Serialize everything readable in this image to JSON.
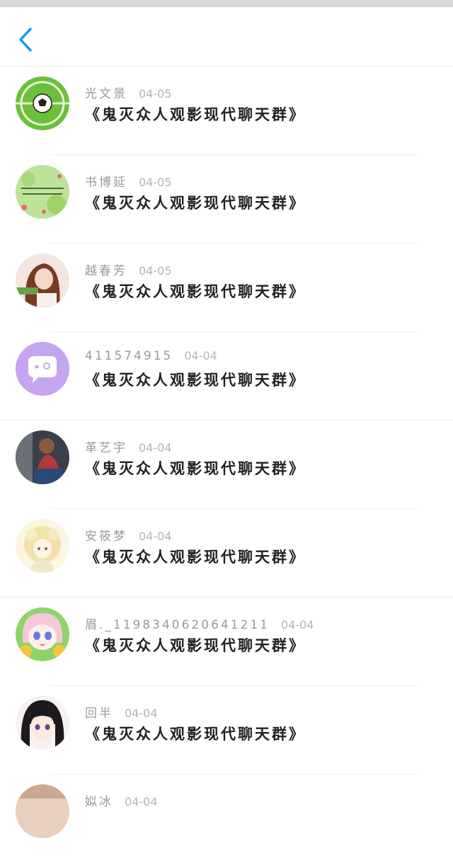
{
  "colors": {
    "accent": "#1a9bf0",
    "name_text": "#9a9a9a",
    "date_text": "#b4b4b4",
    "message_text": "#222222"
  },
  "header": {
    "back_icon": "chevron-left-icon"
  },
  "items": [
    {
      "name": "光文景",
      "date": "04-05",
      "message": "《鬼灭众人观影现代聊天群》",
      "avatar": "soccer-ball-avatar"
    },
    {
      "name": "书博延",
      "date": "04-05",
      "message": "《鬼灭众人观影现代聊天群》",
      "avatar": "green-text-avatar"
    },
    {
      "name": "越春芳",
      "date": "04-05",
      "message": "《鬼灭众人观影现代聊天群》",
      "avatar": "girl-photo-avatar"
    },
    {
      "name": "411574915",
      "date": "04-04",
      "message": "《鬼灭众人观影现代聊天群》",
      "avatar": "chat-bubble-avatar"
    },
    {
      "name": "革艺宇",
      "date": "04-04",
      "message": "《鬼灭众人观影现代聊天群》",
      "avatar": "person-photo-avatar"
    },
    {
      "name": "安筱梦",
      "date": "04-04",
      "message": "《鬼灭众人观影现代聊天群》",
      "avatar": "anime-blonde-avatar"
    },
    {
      "name": "眉._1198340620641211",
      "date": "04-04",
      "message": "《鬼灭众人观影现代聊天群》",
      "avatar": "anime-pink-avatar"
    },
    {
      "name": "回半",
      "date": "04-04",
      "message": "《鬼灭众人观影现代聊天群》",
      "avatar": "anime-darkhair-avatar"
    },
    {
      "name": "姒冰",
      "date": "04-04",
      "message": "",
      "avatar": "partial-avatar"
    }
  ]
}
